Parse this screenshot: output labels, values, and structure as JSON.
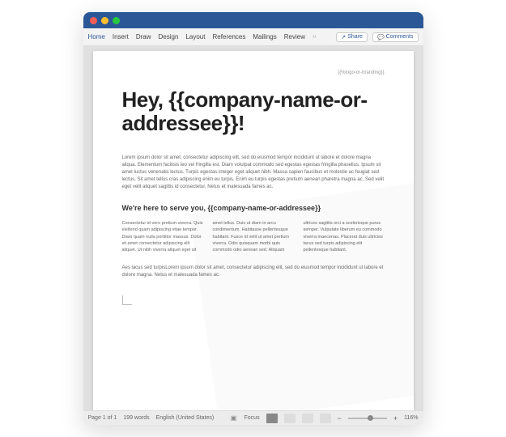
{
  "ribbon": {
    "tabs": [
      "Home",
      "Insert",
      "Draw",
      "Design",
      "Layout",
      "References",
      "Mailings",
      "Review"
    ],
    "more": "››",
    "share": "Share",
    "comments": "Comments"
  },
  "document": {
    "branding": "{{%logo-or-branding}}",
    "headline": "Hey, {{company-name-or-addressee}}!",
    "para1": "Lorem ipsum dolor sit amet, consectetur adipiscing elit, sed do eiusmod tempor incididunt ut labore et dolore magna aliqua. Elementum facilisis leo vel fringilla est. Diam volutpat commodo sed egestas egestas fringilla phasellus. Ipsum sit amet luctus venenatis lectus. Turpis egestas integer eget aliquet nibh. Massa sapien faucibus et molestie ac feugiat sed lectus. Sit amet tellus cras adipiscing enim eu turpis. Enim eu turpis egestas pretium aenean pharetra magna ac. Sed velit eget velit aliquet sagittis id consectetur. Netus et malesuada fames ac.",
    "subhead": "We're here to serve you, {{company-name-or-addressee}}",
    "col1": "Consectetur id vero pretium viverra. Quis eleifend quam adipiscing vitae tempor. Diam quam nulla porttitor massus. Dolor sit amet consectetur adipiscing elit aliquet. Ut nibh viverra aliquet eget sit",
    "col2": "amet tellus. Duis ut diam in arcu condimentum. Habitasse pellentesque habitant. Fusce id velit ut amet pretium viverra. Odio quisquam morbi quis commodo odio aenean sed. Aliquam",
    "col3": "ultrices sagittis orci a scelerisque purus semper. Vulputate liberum eu commodo viverra maecenas. Placerat duis ultricies lacus sed turpis adipiscing elit pellentesque habitant.",
    "para2": "Aes lacus sed turpisLorem ipsum dolor sit amet, consectetur adipiscing elit, sed do eiusmod tempor incididunt ut labore et dolore magna. Netus et malesuada fames ac."
  },
  "status": {
    "page": "Page 1 of 1",
    "words": "199 words",
    "language": "English (United States)",
    "focus": "Focus",
    "zoom": "116%"
  }
}
